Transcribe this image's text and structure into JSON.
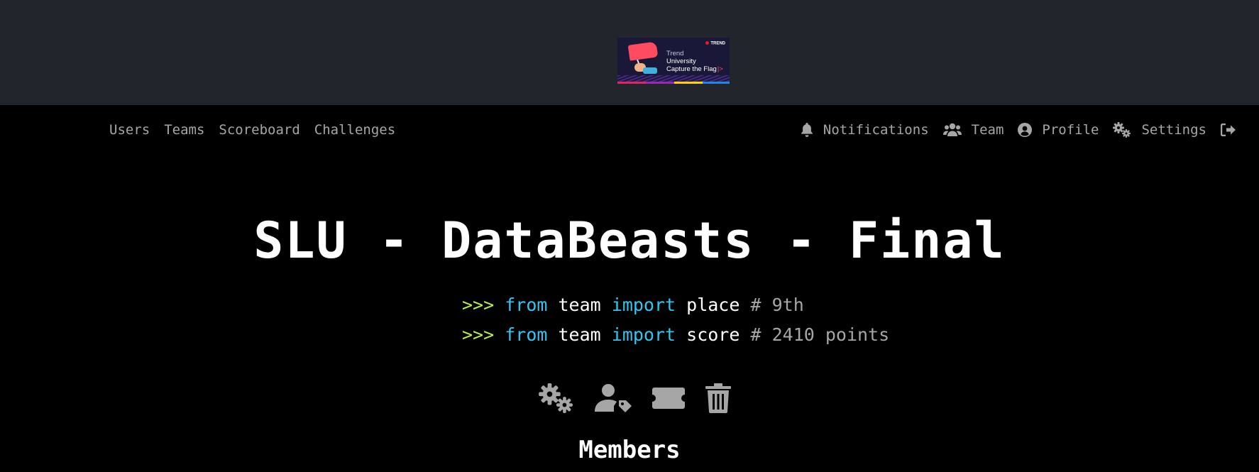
{
  "banner": {
    "brand": "TREND",
    "line1": "Trend",
    "line2": "University",
    "line3": "Capture the Flag"
  },
  "nav": {
    "left": [
      "Users",
      "Teams",
      "Scoreboard",
      "Challenges"
    ],
    "notifications": "Notifications",
    "team": "Team",
    "profile": "Profile",
    "settings": "Settings"
  },
  "team": {
    "title": "SLU - DataBeasts - Final",
    "prompt": ">>>",
    "kw_from": "from",
    "module": "team",
    "kw_import": "import",
    "place_name": "place",
    "place_comment": "# 9th",
    "score_name": "score",
    "score_comment": "# 2410 points"
  },
  "icons": [
    "gears-icon",
    "user-tag-icon",
    "ticket-icon",
    "trash-icon"
  ],
  "colors": {
    "prompt": "#b5f24a",
    "keyword": "#35c4ef",
    "comment": "#a6a6a6",
    "banner_bg": "#22252b"
  },
  "members_heading": "Members"
}
